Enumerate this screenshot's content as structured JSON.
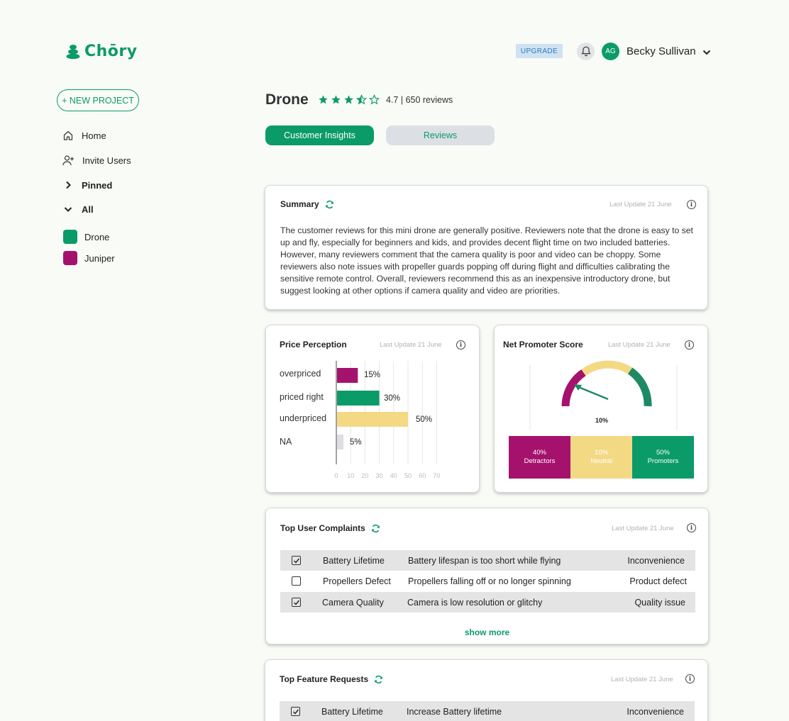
{
  "app": {
    "name": "Chōry"
  },
  "header": {
    "upgrade_label": "UPGRADE",
    "avatar_initials": "AG",
    "user_name": "Becky Sullivan"
  },
  "sidebar": {
    "new_project_label": "+ NEW PROJECT",
    "nav": [
      {
        "label": "Home",
        "icon": "home-icon"
      },
      {
        "label": "Invite Users",
        "icon": "add-user-icon"
      },
      {
        "label": "Pinned",
        "icon": "chevron-right-icon"
      },
      {
        "label": "All",
        "icon": "chevron-down-icon"
      }
    ],
    "projects": [
      {
        "label": "Drone",
        "color": "#0b9b68"
      },
      {
        "label": "Juniper",
        "color": "#a5126e"
      }
    ]
  },
  "product": {
    "title": "Drone",
    "rating": 4.7,
    "rating_text": "4.7 | 650 reviews",
    "tabs": [
      "Customer Insights",
      "Reviews"
    ]
  },
  "summary": {
    "title": "Summary",
    "updated": "Last Update 21 June",
    "text": "The customer reviews for this mini drone are generally positive. Reviewers note that the drone is easy to set up and fly, especially for beginners and kids, and provides decent flight time on two included batteries. However, many reviewers comment that the camera quality is poor and video can be choppy. Some reviewers also note issues with propeller guards popping off during flight and difficulties calibrating the sensitive remote control. Overall, reviewers recommend this as an inexpensive introductory drone, but suggest looking at other options if camera quality and video are priorities."
  },
  "price_perception": {
    "title": "Price Perception",
    "updated": "Last Update 21 June",
    "value_labels": [
      "15%",
      "30%",
      "50%",
      "5%"
    ]
  },
  "nps": {
    "title": "Net Promoter Score",
    "updated": "Last Update 21 June",
    "score_label": "10%",
    "segments": [
      {
        "pct": "40%",
        "label": "Detractors",
        "color": "#a5126e"
      },
      {
        "pct": "10%",
        "label": "Neutral",
        "color": "#f4d984"
      },
      {
        "pct": "50%",
        "label": "Promoters",
        "color": "#0b9b68"
      }
    ]
  },
  "chart_data": {
    "type": "bar",
    "orientation": "horizontal",
    "categories": [
      "overpriced",
      "priced right",
      "underpriced",
      "NA"
    ],
    "values": [
      15,
      30,
      50,
      5
    ],
    "colors": [
      "#a5126e",
      "#0b9b68",
      "#f4d984",
      "#dcdee4"
    ],
    "xlim": [
      0,
      70
    ],
    "xticks": [
      0,
      10,
      20,
      30,
      40,
      50,
      60,
      70
    ],
    "grid": true
  },
  "complaints": {
    "title": "Top User Complaints",
    "updated": "Last Update 21 June",
    "show_more": "show more",
    "rows": [
      {
        "checked": true,
        "feature": "Battery Lifetime",
        "description": "Battery lifespan is too short while flying",
        "category": "Inconvenience"
      },
      {
        "checked": false,
        "feature": "Propellers Defect",
        "description": "Propellers falling off or no longer spinning",
        "category": "Product defect"
      },
      {
        "checked": true,
        "feature": "Camera Quality",
        "description": "Camera is low resolution or glitchy",
        "category": "Quality issue"
      }
    ]
  },
  "feature_requests": {
    "title": "Top Feature Requests",
    "updated": "Last Update 21 June",
    "rows": [
      {
        "checked": true,
        "feature": "Battery Lifetime",
        "description": "Increase Battery lifetime",
        "category": "Inconvenience"
      }
    ]
  }
}
